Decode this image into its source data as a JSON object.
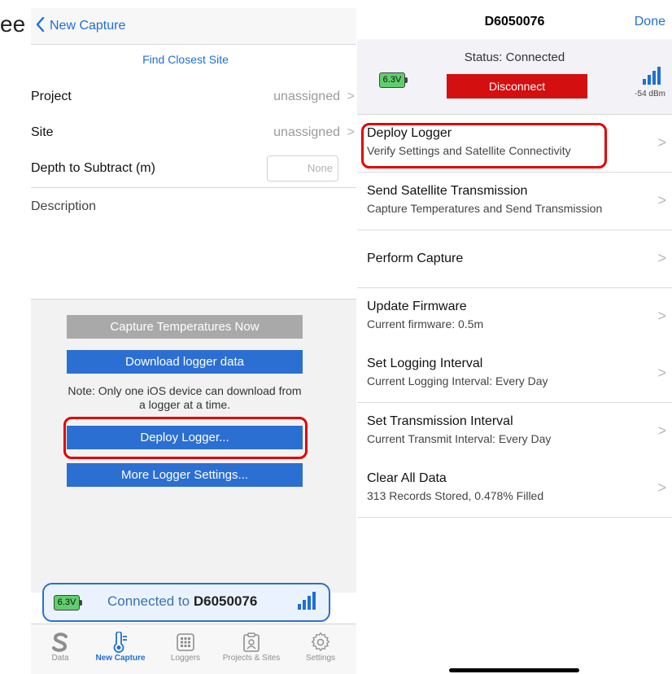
{
  "background": {
    "fragment": "ee"
  },
  "left": {
    "nav_back_label": "New Capture",
    "find_site_label": "Find Closest Site",
    "rows": [
      {
        "label": "Project",
        "value": "unassigned",
        "chevron": ">"
      },
      {
        "label": "Site",
        "value": "unassigned",
        "chevron": ">"
      }
    ],
    "depth_label": "Depth to Subtract (m)",
    "depth_placeholder": "None",
    "description_label": "Description",
    "buttons": {
      "capture": "Capture Temperatures Now",
      "download": "Download logger data",
      "deploy": "Deploy Logger...",
      "more": "More Logger Settings..."
    },
    "note": "Note: Only one iOS device can download from a logger at a time.",
    "connection": {
      "battery": "6.3V",
      "prefix": "Connected to",
      "device": "D6050076"
    },
    "tabs": [
      {
        "label": "Data",
        "icon": "data-s-icon",
        "active": false
      },
      {
        "label": "New Capture",
        "icon": "thermometer-icon",
        "active": true
      },
      {
        "label": "Loggers",
        "icon": "loggers-grid-icon",
        "active": false
      },
      {
        "label": "Projects & Sites",
        "icon": "projects-icon",
        "active": false
      },
      {
        "label": "Settings",
        "icon": "gear-icon",
        "active": false
      }
    ]
  },
  "right": {
    "title": "D6050076",
    "done_label": "Done",
    "status_label": "Status: Connected",
    "disconnect_label": "Disconnect",
    "battery": "6.3V",
    "signal": "-54 dBm",
    "items": [
      {
        "title": "Deploy Logger",
        "subtitle": "Verify Settings and Satellite Connectivity"
      },
      {
        "title": "Send Satellite Transmission",
        "subtitle": "Capture Temperatures and Send Transmission"
      },
      {
        "title": "Perform Capture",
        "subtitle": ""
      },
      {
        "title": "Update Firmware",
        "subtitle": "Current firmware: 0.5m"
      },
      {
        "title": "Set Logging Interval",
        "subtitle": "Current Logging Interval: Every Day"
      },
      {
        "title": "Set Transmission Interval",
        "subtitle": "Current Transmit Interval: Every Day"
      },
      {
        "title": "Clear All Data",
        "subtitle": "313 Records Stored, 0.478% Filled"
      }
    ],
    "chevron": ">"
  },
  "colors": {
    "accent": "#2b6fd3",
    "danger": "#d30f0f",
    "highlight": "#e40000",
    "battery": "#5fcf6b"
  }
}
